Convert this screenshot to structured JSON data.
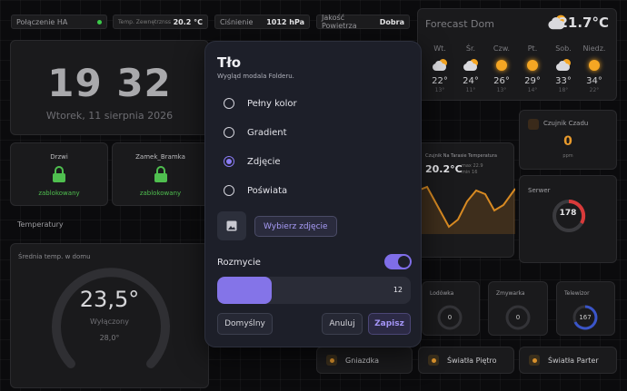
{
  "status_bar": {
    "ha_connection": "Połączenie HA",
    "outdoor_temp_label": "Temp. Zewnętrznss",
    "outdoor_temp_value": "20.2 °C",
    "pressure_label": "Ciśnienie",
    "pressure_value": "1012 hPa",
    "air_quality_label": "Jakość Powietrza",
    "air_quality_value": "Dobra"
  },
  "clock": {
    "hours": "19",
    "minutes": "32",
    "date": "Wtorek, 11 sierpnia 2026"
  },
  "locks": [
    {
      "name": "Drzwi",
      "status": "zablokowany"
    },
    {
      "name": "Zamek_Bramka",
      "status": "zablokowany"
    }
  ],
  "temperature_section": {
    "label": "Temperatury",
    "card_title": "Średnia temp. w domu",
    "value": "23,5°",
    "mode": "Wyłączony",
    "target": "28,0°"
  },
  "forecast": {
    "title": "Forecast Dom",
    "current_temp": "21.7°C",
    "days": [
      {
        "day": "Wt.",
        "icon": "partly-cloudy-icon",
        "high": "22°",
        "low": "13°"
      },
      {
        "day": "Śr.",
        "icon": "partly-cloudy-icon",
        "high": "24°",
        "low": "11°"
      },
      {
        "day": "Czw.",
        "icon": "sun-icon",
        "high": "26°",
        "low": "13°"
      },
      {
        "day": "Pt.",
        "icon": "sun-icon",
        "high": "29°",
        "low": "14°"
      },
      {
        "day": "Sob.",
        "icon": "partly-cloudy-icon",
        "high": "33°",
        "low": "18°"
      },
      {
        "day": "Niedz.",
        "icon": "sun-icon",
        "high": "34°",
        "low": "22°"
      }
    ]
  },
  "sensor_chart": {
    "title": "Czujnik Na Tarasie Temperatura",
    "value": "20.2°C",
    "max": "max 22.9",
    "min": "min 16"
  },
  "dust_sensor": {
    "title": "Czujnik Czadu",
    "value": "0",
    "unit": "ppm"
  },
  "server": {
    "title": "Serwer",
    "value": "178"
  },
  "appliances": [
    {
      "name": "Lodówka",
      "value": "0"
    },
    {
      "name": "Zmywarka",
      "value": "0"
    },
    {
      "name": "Telewizor",
      "value": "167"
    }
  ],
  "bottom_buttons": {
    "outlet": "Gniazdka",
    "floor_lights": "Światła Piętro",
    "ground_lights": "Światła Parter"
  },
  "modal": {
    "title": "Tło",
    "subtitle": "Wygląd modala Folderu.",
    "options": [
      "Pełny kolor",
      "Gradient",
      "Zdjęcie",
      "Poświata"
    ],
    "selected_option": "Zdjęcie",
    "choose_photo": "Wybierz zdjęcie",
    "blur_label": "Rozmycie",
    "blur_enabled": true,
    "blur_value": "12",
    "blur_fraction": 0.28,
    "default_button": "Domyślny",
    "cancel_button": "Anuluj",
    "save_button": "Zapisz",
    "accent_color": "#8474e8"
  }
}
